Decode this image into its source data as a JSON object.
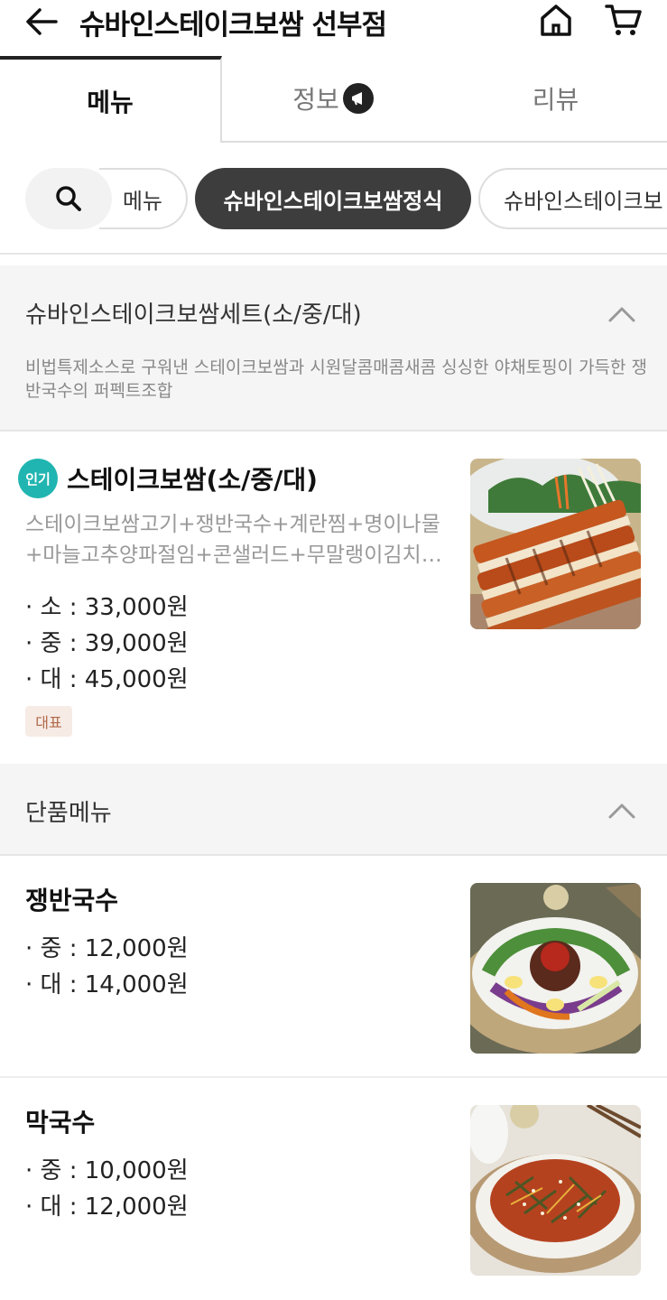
{
  "header": {
    "title": "슈바인스테이크보쌈 선부점",
    "back_icon": "arrow-left-icon",
    "home_icon": "home-icon",
    "cart_icon": "cart-icon"
  },
  "tabs": [
    {
      "label": "메뉴",
      "active": true
    },
    {
      "label": "정보",
      "active": false,
      "icon": "megaphone-icon"
    },
    {
      "label": "리뷰",
      "active": false
    }
  ],
  "categories": {
    "search_icon": "search-icon",
    "items": [
      "메뉴",
      "슈바인스테이크보쌈정식",
      "슈바인스테이크보"
    ],
    "active": "슈바인스테이크보쌈정식"
  },
  "sections": [
    {
      "title": "슈바인스테이크보쌈세트(소/중/대)",
      "description": "비법특제소스로 구워낸 스테이크보쌈과 시원달콤매콤새콤 싱싱한 야채토핑이 가득한 쟁반국수의 퍼펙트조합",
      "items": [
        {
          "badge": "인기",
          "name": "스테이크보쌈(소/중/대)",
          "description": "스테이크보쌈고기+쟁반국수+계란찜+명이나물+마늘고추양파절임+콘샐러드+무말랭이김치…",
          "prices": [
            "· 소 : 33,000원",
            "· 중 : 39,000원",
            "· 대 : 45,000원"
          ],
          "tag": "대표"
        }
      ]
    },
    {
      "title": "단품메뉴",
      "items": [
        {
          "name": "쟁반국수",
          "prices": [
            "· 중 : 12,000원",
            "· 대 : 14,000원"
          ]
        },
        {
          "name": "막국수",
          "prices": [
            "· 중 : 10,000원",
            "· 대 : 12,000원"
          ]
        }
      ]
    }
  ],
  "colors": {
    "accent_dark": "#3d3d3d",
    "popular_badge": "#20b5b0",
    "section_bg": "#f5f5f5",
    "rep_tag_bg": "#f7ebe6"
  }
}
